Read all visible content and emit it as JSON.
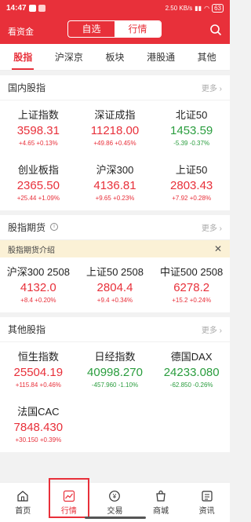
{
  "status": {
    "time": "14:47",
    "speed": "2.50 KB/s",
    "battery": "63"
  },
  "header": {
    "left_text": "看资金",
    "seg_off": "自选",
    "seg_on": "行情"
  },
  "tabs": [
    "股指",
    "沪深京",
    "板块",
    "港股通",
    "其他"
  ],
  "domestic": {
    "title": "国内股指",
    "more": "更多 ›",
    "items": [
      {
        "name": "上证指数",
        "value": "3598.31",
        "change": "+4.65  +0.13%",
        "dir": "up"
      },
      {
        "name": "深证成指",
        "value": "11218.00",
        "change": "+49.86  +0.45%",
        "dir": "up"
      },
      {
        "name": "北证50",
        "value": "1453.59",
        "change": "-5.39  -0.37%",
        "dir": "down"
      },
      {
        "name": "创业板指",
        "value": "2365.50",
        "change": "+25.44  +1.09%",
        "dir": "up"
      },
      {
        "name": "沪深300",
        "value": "4136.81",
        "change": "+9.65  +0.23%",
        "dir": "up"
      },
      {
        "name": "上证50",
        "value": "2803.43",
        "change": "+7.92  +0.28%",
        "dir": "up"
      }
    ]
  },
  "futures": {
    "title": "股指期货",
    "more": "更多 ›",
    "banner": "股指期货介绍",
    "items": [
      {
        "name": "沪深300 2508",
        "value": "4132.0",
        "change": "+8.4  +0.20%",
        "dir": "up"
      },
      {
        "name": "上证50 2508",
        "value": "2804.4",
        "change": "+9.4  +0.34%",
        "dir": "up"
      },
      {
        "name": "中证500 2508",
        "value": "6278.2",
        "change": "+15.2  +0.24%",
        "dir": "up"
      }
    ]
  },
  "other": {
    "title": "其他股指",
    "more": "更多 ›",
    "items": [
      {
        "name": "恒生指数",
        "value": "25504.19",
        "change": "+115.84  +0.46%",
        "dir": "up"
      },
      {
        "name": "日经指数",
        "value": "40998.270",
        "change": "-457.960  -1.10%",
        "dir": "down"
      },
      {
        "name": "德国DAX",
        "value": "24233.080",
        "change": "-62.850  -0.26%",
        "dir": "down"
      },
      {
        "name": "法国CAC",
        "value": "7848.430",
        "change": "+30.150  +0.39%",
        "dir": "up"
      }
    ]
  },
  "bottom_nav": [
    {
      "label": "首页",
      "icon": "home-icon"
    },
    {
      "label": "行情",
      "icon": "chart-icon"
    },
    {
      "label": "交易",
      "icon": "trade-icon"
    },
    {
      "label": "商城",
      "icon": "mall-icon"
    },
    {
      "label": "资讯",
      "icon": "news-icon"
    }
  ],
  "colors": {
    "accent": "#e8303a",
    "up": "#e8303a",
    "down": "#2a9d3e",
    "banner_bg": "#fbf1d6"
  }
}
